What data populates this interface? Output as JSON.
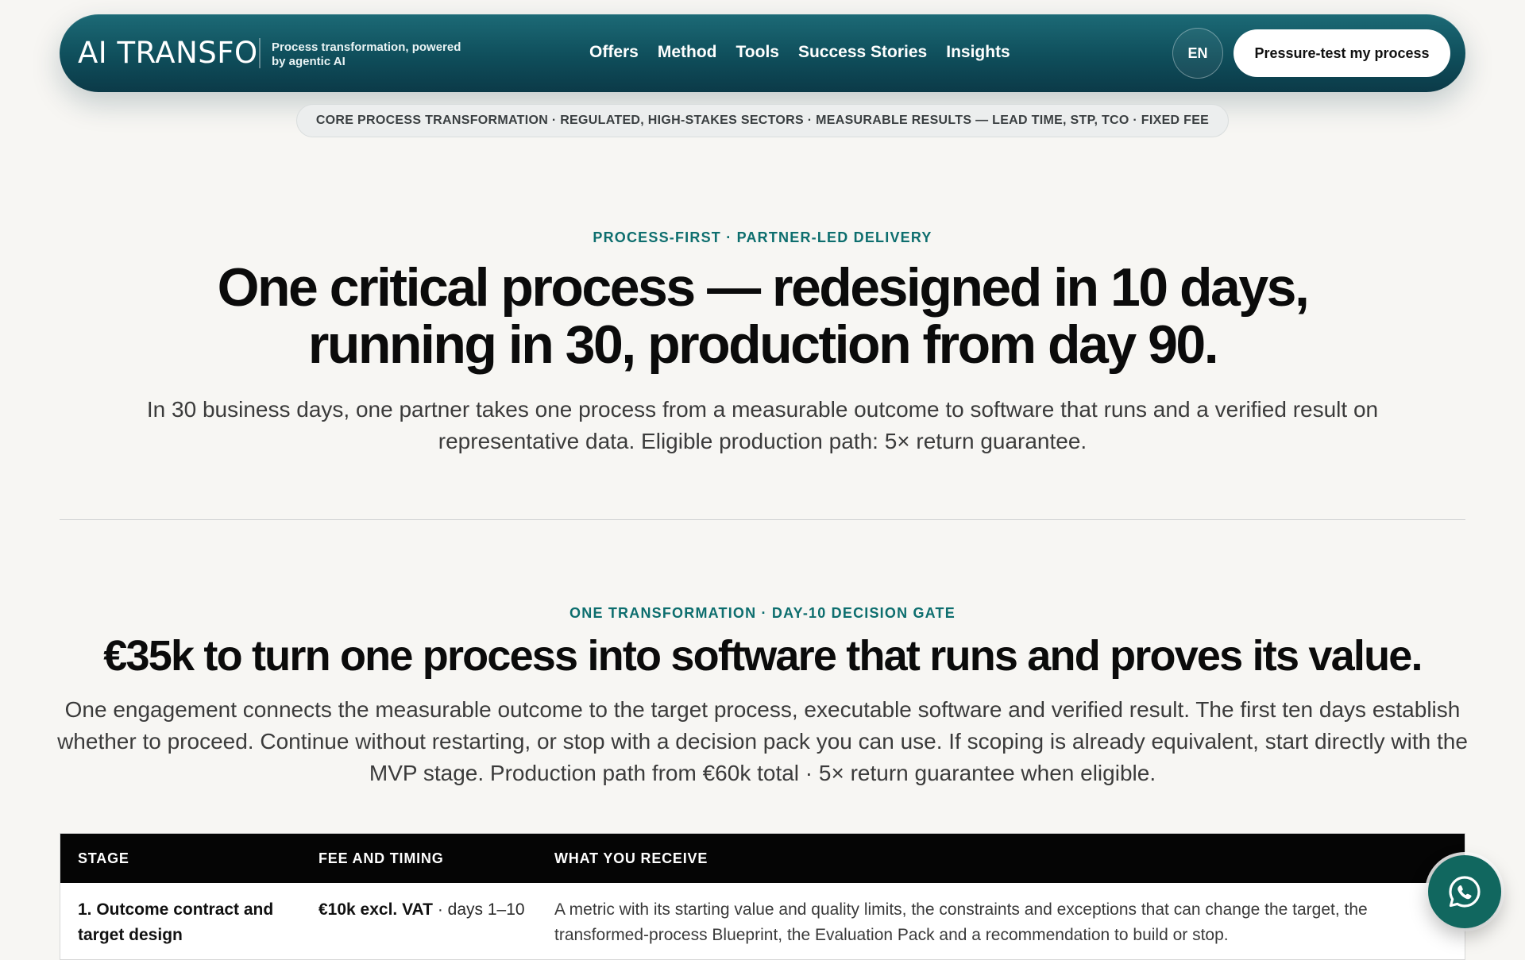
{
  "header": {
    "logo": "AI TRANSFO",
    "tagline": "Process transformation, powered by agentic AI",
    "nav": [
      "Offers",
      "Method",
      "Tools",
      "Success Stories",
      "Insights"
    ],
    "language": "EN",
    "cta": "Pressure-test my process"
  },
  "banner": "CORE PROCESS TRANSFORMATION · REGULATED, HIGH-STAKES SECTORS · MEASURABLE RESULTS — LEAD TIME, STP, TCO · FIXED FEE",
  "hero": {
    "eyebrow": "PROCESS-FIRST · PARTNER-LED DELIVERY",
    "title": "One critical process — redesigned in 10 days, running in 30, production from day 90.",
    "lead": "In 30 business days, one partner takes one process from a measurable outcome to software that runs and a verified result on representative data. Eligible production path: 5× return guarantee."
  },
  "offer": {
    "eyebrow": "ONE TRANSFORMATION · DAY-10 DECISION GATE",
    "title": "€35k to turn one process into software that runs and proves its value.",
    "lead": "One engagement connects the measurable outcome to the target process, executable software and verified result. The first ten days establish whether to proceed. Continue without restarting, or stop with a decision pack you can use. If scoping is already equivalent, start directly with the MVP stage. Production path from €60k total · 5× return guarantee when eligible."
  },
  "table": {
    "headers": [
      "STAGE",
      "FEE AND TIMING",
      "WHAT YOU RECEIVE"
    ],
    "rows": [
      {
        "stage": "1. Outcome contract and target design",
        "fee": "€10k excl. VAT",
        "timing": " · days 1–10",
        "receive_line1": "A metric with its starting value and quality limits, the constraints and exceptions that can change the target, the",
        "receive_line2": "transformed-process Blueprint, the Evaluation Pack and a recommendation to build or stop."
      }
    ]
  },
  "icons": {
    "floating": "whatsapp-icon"
  },
  "colors": {
    "accent": "#0d6e6e",
    "header": "#0f4e5b",
    "chat_button": "#11675f"
  }
}
